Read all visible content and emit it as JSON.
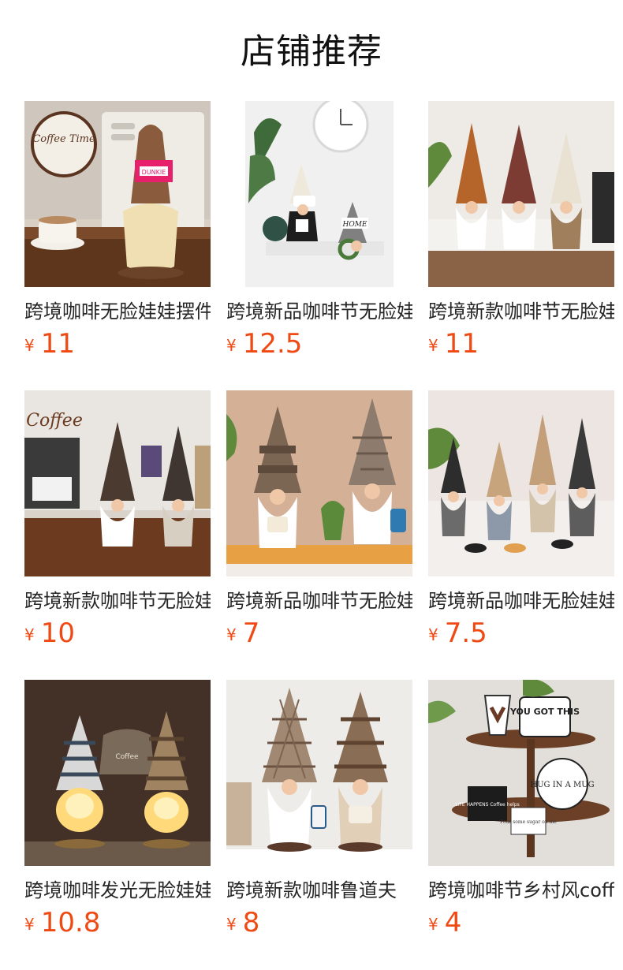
{
  "header": {
    "title": "店铺推荐"
  },
  "colors": {
    "price": "#ef4a14"
  },
  "products": [
    {
      "name": "跨境咖啡无脸娃娃摆件",
      "currency": "¥",
      "price": "11",
      "image": "gnome-coffee-machine-pink-hat"
    },
    {
      "name": "跨境新品咖啡节无脸娃娃",
      "currency": "¥",
      "price": "12.5",
      "image": "gnome-pair-white-background"
    },
    {
      "name": "跨境新款咖啡节无脸娃娃",
      "currency": "¥",
      "price": "11",
      "image": "gnome-trio-brown-plaid-white"
    },
    {
      "name": "跨境新款咖啡节无脸娃娃",
      "currency": "¥",
      "price": "10",
      "image": "gnome-pair-coffee-shelf"
    },
    {
      "name": "跨境新品咖啡节无脸娃娃",
      "currency": "¥",
      "price": "7",
      "image": "gnome-pair-striped-plaid-wood"
    },
    {
      "name": "跨境新品咖啡无脸娃娃",
      "currency": "¥",
      "price": "7.5",
      "image": "gnome-quartet-grey-tan"
    },
    {
      "name": "跨境咖啡发光无脸娃娃",
      "currency": "¥",
      "price": "10.8",
      "image": "gnome-pair-glowing"
    },
    {
      "name": "跨境新款咖啡鲁道夫",
      "currency": "¥",
      "price": "8",
      "image": "gnome-pair-plaid-striped-cups"
    },
    {
      "name": "跨境咖啡节乡村风coffee",
      "currency": "¥",
      "price": "4",
      "image": "tiered-tray-coffee-signs"
    }
  ],
  "image_text": {
    "coffee_time": "Coffee Time",
    "dunkie": "DUNKIE",
    "home": "HOME",
    "coffee": "Coffee",
    "you_got_this": "YOU GOT THIS",
    "hug_in_a_mug": "HUG IN A MUG",
    "life_happens": "LIFE HAPPENS Coffee helps",
    "pour_sugar": "Pour some sugar on me"
  }
}
